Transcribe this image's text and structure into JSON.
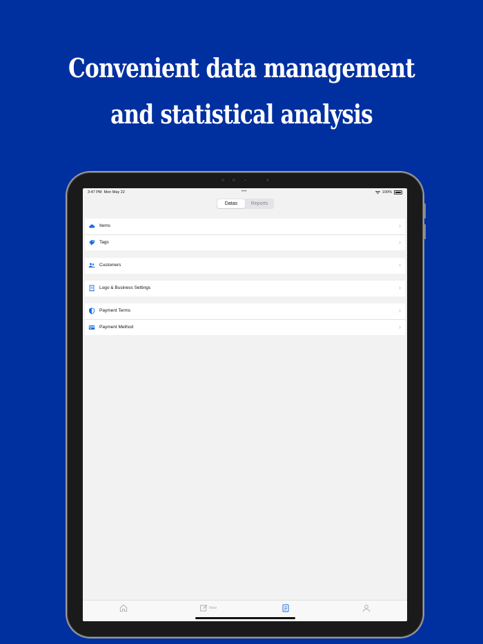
{
  "headline": {
    "line1": "Convenient data management",
    "line2": "and statistical analysis"
  },
  "status_bar": {
    "time": "3:47 PM",
    "date": "Mon May 22",
    "multitask": "•••",
    "battery": "100%"
  },
  "segmented": {
    "datas": "Datas",
    "reports": "Reports",
    "selected": "Datas"
  },
  "groups": [
    {
      "items": [
        {
          "label": "Items",
          "icon": "cloud-icon"
        },
        {
          "label": "Tags",
          "icon": "tag-icon"
        }
      ]
    },
    {
      "items": [
        {
          "label": "Customers",
          "icon": "people-icon"
        }
      ]
    },
    {
      "items": [
        {
          "label": "Logo & Business Settings",
          "icon": "document-icon"
        }
      ]
    },
    {
      "items": [
        {
          "label": "Payment Terms",
          "icon": "shield-icon"
        },
        {
          "label": "Payment Method",
          "icon": "credit-card-icon"
        }
      ]
    }
  ],
  "tabbar": {
    "new_label": "New",
    "tabs": [
      "home-icon",
      "compose-icon",
      "list-icon",
      "person-icon"
    ],
    "active": "list-icon"
  },
  "colors": {
    "background": "#0030a0",
    "accent": "#1a6fe0"
  }
}
